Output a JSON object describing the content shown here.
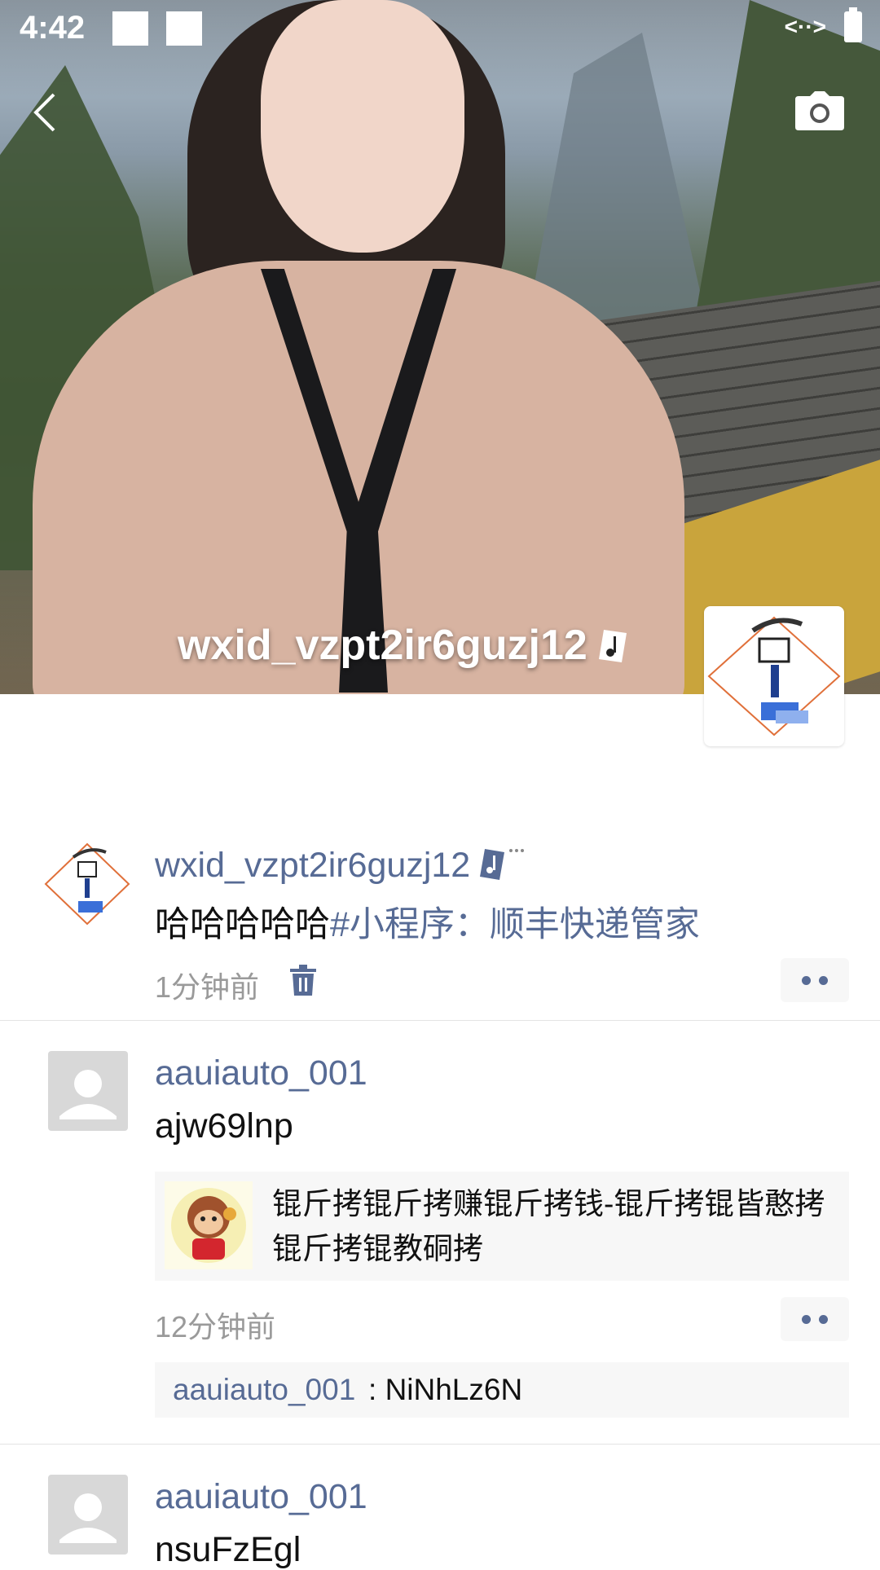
{
  "status_bar": {
    "time": "4:42",
    "data_icon": "<··>",
    "battery_icon": "battery-icon"
  },
  "header": {
    "back_icon": "back-chevron-icon",
    "camera_icon": "camera-icon"
  },
  "profile": {
    "nickname": "wxid_vzpt2ir6guzj12"
  },
  "feed": [
    {
      "nickname": "wxid_vzpt2ir6guzj12",
      "text": "哈哈哈哈哈",
      "link": "#小程序：顺丰快递管家",
      "time": "1分钟前",
      "delete_icon": "trash-icon"
    },
    {
      "nickname": "aauiauto_001",
      "text": "ajw69lnp",
      "share_title": "锟斤拷锟斤拷赚锟斤拷钱-锟斤拷锟皆憨拷锟斤拷锟教硐拷",
      "time": "12分钟前",
      "comment_author": "aauiauto_001",
      "comment_sep": ": ",
      "comment_text": "NiNhLz6N"
    },
    {
      "nickname": "aauiauto_001",
      "text": "nsuFzEgl"
    }
  ],
  "colors": {
    "link": "#576b95",
    "time": "#9a9a9a"
  }
}
